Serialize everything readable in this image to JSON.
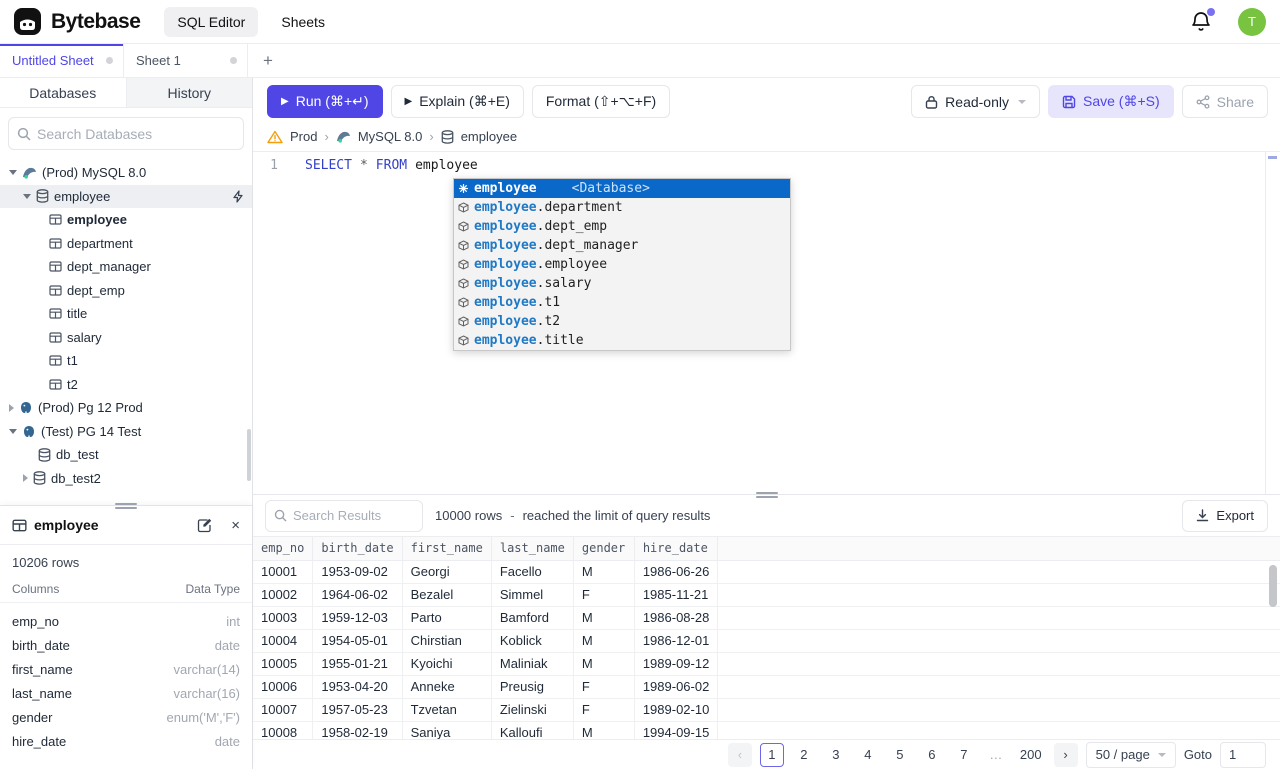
{
  "header": {
    "brand": "Bytebase",
    "nav_sql_editor": "SQL Editor",
    "nav_sheets": "Sheets",
    "avatar_text": "T"
  },
  "sheet_tabs": {
    "tab1": "Untitled Sheet",
    "tab2": "Sheet 1",
    "add": "+"
  },
  "sidebar": {
    "tab_databases": "Databases",
    "tab_history": "History",
    "search_placeholder": "Search Databases",
    "tree": {
      "mysql_group": "(Prod) MySQL 8.0",
      "db_employee": "employee",
      "tables": [
        "employee",
        "department",
        "dept_manager",
        "dept_emp",
        "title",
        "salary",
        "t1",
        "t2"
      ],
      "pg_prod_group": "(Prod) Pg 12 Prod",
      "pg_test_group": "(Test) PG 14 Test",
      "pg_dbs": [
        "db_test",
        "db_test2"
      ]
    },
    "schema_panel": {
      "title": "employee",
      "row_count": "10206 rows",
      "columns_header": "Columns",
      "datatype_header": "Data Type",
      "columns": [
        {
          "name": "emp_no",
          "type": "int"
        },
        {
          "name": "birth_date",
          "type": "date"
        },
        {
          "name": "first_name",
          "type": "varchar(14)"
        },
        {
          "name": "last_name",
          "type": "varchar(16)"
        },
        {
          "name": "gender",
          "type": "enum('M','F')"
        },
        {
          "name": "hire_date",
          "type": "date"
        }
      ]
    }
  },
  "toolbar": {
    "run": "Run (⌘+↵)",
    "explain": "Explain (⌘+E)",
    "format": "Format (⇧+⌥+F)",
    "readonly": "Read-only",
    "save": "Save (⌘+S)",
    "share": "Share"
  },
  "breadcrumb": {
    "env": "Prod",
    "instance": "MySQL 8.0",
    "database": "employee",
    "sep": "›"
  },
  "editor": {
    "line_number": "1",
    "kw1": "SELECT",
    "star": "*",
    "kw2": "FROM",
    "table": "employee",
    "autocomplete": {
      "selected_label": "employee",
      "selected_kind": "<Database>",
      "items": [
        {
          "prefix": "employee",
          "suffix": ".department"
        },
        {
          "prefix": "employee",
          "suffix": ".dept_emp"
        },
        {
          "prefix": "employee",
          "suffix": ".dept_manager"
        },
        {
          "prefix": "employee",
          "suffix": ".employee"
        },
        {
          "prefix": "employee",
          "suffix": ".salary"
        },
        {
          "prefix": "employee",
          "suffix": ".t1"
        },
        {
          "prefix": "employee",
          "suffix": ".t2"
        },
        {
          "prefix": "employee",
          "suffix": ".title"
        }
      ]
    }
  },
  "results": {
    "search_placeholder": "Search Results",
    "rows_info": "10000 rows",
    "dash": "-",
    "limit_note": "reached the limit of query results",
    "export_label": "Export",
    "table": {
      "headers": [
        "emp_no",
        "birth_date",
        "first_name",
        "last_name",
        "gender",
        "hire_date"
      ],
      "rows": [
        [
          "10001",
          "1953-09-02",
          "Georgi",
          "Facello",
          "M",
          "1986-06-26"
        ],
        [
          "10002",
          "1964-06-02",
          "Bezalel",
          "Simmel",
          "F",
          "1985-11-21"
        ],
        [
          "10003",
          "1959-12-03",
          "Parto",
          "Bamford",
          "M",
          "1986-08-28"
        ],
        [
          "10004",
          "1954-05-01",
          "Chirstian",
          "Koblick",
          "M",
          "1986-12-01"
        ],
        [
          "10005",
          "1955-01-21",
          "Kyoichi",
          "Maliniak",
          "M",
          "1989-09-12"
        ],
        [
          "10006",
          "1953-04-20",
          "Anneke",
          "Preusig",
          "F",
          "1989-06-02"
        ],
        [
          "10007",
          "1957-05-23",
          "Tzvetan",
          "Zielinski",
          "F",
          "1989-02-10"
        ],
        [
          "10008",
          "1958-02-19",
          "Saniya",
          "Kalloufi",
          "M",
          "1994-09-15"
        ]
      ]
    },
    "pagination": {
      "pages": [
        "1",
        "2",
        "3",
        "4",
        "5",
        "6",
        "7"
      ],
      "ellipsis": "…",
      "last_page": "200",
      "page_size": "50 / page",
      "goto_label": "Goto",
      "goto_value": "1"
    }
  }
}
